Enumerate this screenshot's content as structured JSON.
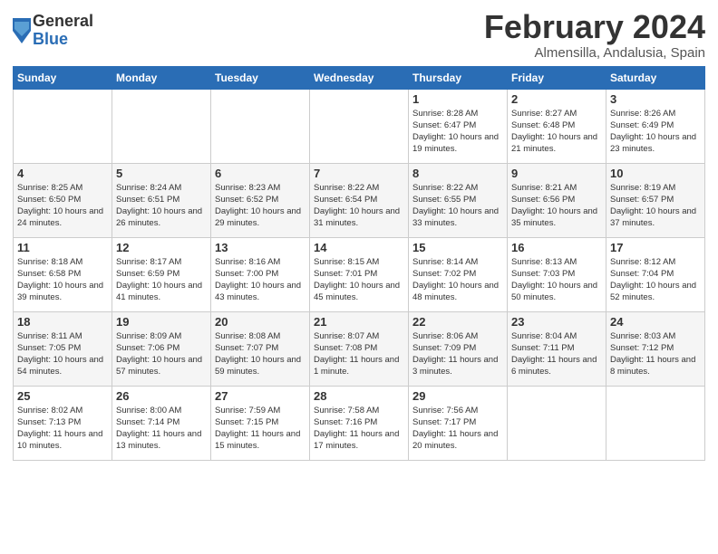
{
  "header": {
    "logo_general": "General",
    "logo_blue": "Blue",
    "month_year": "February 2024",
    "location": "Almensilla, Andalusia, Spain"
  },
  "days_of_week": [
    "Sunday",
    "Monday",
    "Tuesday",
    "Wednesday",
    "Thursday",
    "Friday",
    "Saturday"
  ],
  "weeks": [
    [
      {
        "day": "",
        "info": ""
      },
      {
        "day": "",
        "info": ""
      },
      {
        "day": "",
        "info": ""
      },
      {
        "day": "",
        "info": ""
      },
      {
        "day": "1",
        "info": "Sunrise: 8:28 AM\nSunset: 6:47 PM\nDaylight: 10 hours\nand 19 minutes."
      },
      {
        "day": "2",
        "info": "Sunrise: 8:27 AM\nSunset: 6:48 PM\nDaylight: 10 hours\nand 21 minutes."
      },
      {
        "day": "3",
        "info": "Sunrise: 8:26 AM\nSunset: 6:49 PM\nDaylight: 10 hours\nand 23 minutes."
      }
    ],
    [
      {
        "day": "4",
        "info": "Sunrise: 8:25 AM\nSunset: 6:50 PM\nDaylight: 10 hours\nand 24 minutes."
      },
      {
        "day": "5",
        "info": "Sunrise: 8:24 AM\nSunset: 6:51 PM\nDaylight: 10 hours\nand 26 minutes."
      },
      {
        "day": "6",
        "info": "Sunrise: 8:23 AM\nSunset: 6:52 PM\nDaylight: 10 hours\nand 29 minutes."
      },
      {
        "day": "7",
        "info": "Sunrise: 8:22 AM\nSunset: 6:54 PM\nDaylight: 10 hours\nand 31 minutes."
      },
      {
        "day": "8",
        "info": "Sunrise: 8:22 AM\nSunset: 6:55 PM\nDaylight: 10 hours\nand 33 minutes."
      },
      {
        "day": "9",
        "info": "Sunrise: 8:21 AM\nSunset: 6:56 PM\nDaylight: 10 hours\nand 35 minutes."
      },
      {
        "day": "10",
        "info": "Sunrise: 8:19 AM\nSunset: 6:57 PM\nDaylight: 10 hours\nand 37 minutes."
      }
    ],
    [
      {
        "day": "11",
        "info": "Sunrise: 8:18 AM\nSunset: 6:58 PM\nDaylight: 10 hours\nand 39 minutes."
      },
      {
        "day": "12",
        "info": "Sunrise: 8:17 AM\nSunset: 6:59 PM\nDaylight: 10 hours\nand 41 minutes."
      },
      {
        "day": "13",
        "info": "Sunrise: 8:16 AM\nSunset: 7:00 PM\nDaylight: 10 hours\nand 43 minutes."
      },
      {
        "day": "14",
        "info": "Sunrise: 8:15 AM\nSunset: 7:01 PM\nDaylight: 10 hours\nand 45 minutes."
      },
      {
        "day": "15",
        "info": "Sunrise: 8:14 AM\nSunset: 7:02 PM\nDaylight: 10 hours\nand 48 minutes."
      },
      {
        "day": "16",
        "info": "Sunrise: 8:13 AM\nSunset: 7:03 PM\nDaylight: 10 hours\nand 50 minutes."
      },
      {
        "day": "17",
        "info": "Sunrise: 8:12 AM\nSunset: 7:04 PM\nDaylight: 10 hours\nand 52 minutes."
      }
    ],
    [
      {
        "day": "18",
        "info": "Sunrise: 8:11 AM\nSunset: 7:05 PM\nDaylight: 10 hours\nand 54 minutes."
      },
      {
        "day": "19",
        "info": "Sunrise: 8:09 AM\nSunset: 7:06 PM\nDaylight: 10 hours\nand 57 minutes."
      },
      {
        "day": "20",
        "info": "Sunrise: 8:08 AM\nSunset: 7:07 PM\nDaylight: 10 hours\nand 59 minutes."
      },
      {
        "day": "21",
        "info": "Sunrise: 8:07 AM\nSunset: 7:08 PM\nDaylight: 11 hours\nand 1 minute."
      },
      {
        "day": "22",
        "info": "Sunrise: 8:06 AM\nSunset: 7:09 PM\nDaylight: 11 hours\nand 3 minutes."
      },
      {
        "day": "23",
        "info": "Sunrise: 8:04 AM\nSunset: 7:11 PM\nDaylight: 11 hours\nand 6 minutes."
      },
      {
        "day": "24",
        "info": "Sunrise: 8:03 AM\nSunset: 7:12 PM\nDaylight: 11 hours\nand 8 minutes."
      }
    ],
    [
      {
        "day": "25",
        "info": "Sunrise: 8:02 AM\nSunset: 7:13 PM\nDaylight: 11 hours\nand 10 minutes."
      },
      {
        "day": "26",
        "info": "Sunrise: 8:00 AM\nSunset: 7:14 PM\nDaylight: 11 hours\nand 13 minutes."
      },
      {
        "day": "27",
        "info": "Sunrise: 7:59 AM\nSunset: 7:15 PM\nDaylight: 11 hours\nand 15 minutes."
      },
      {
        "day": "28",
        "info": "Sunrise: 7:58 AM\nSunset: 7:16 PM\nDaylight: 11 hours\nand 17 minutes."
      },
      {
        "day": "29",
        "info": "Sunrise: 7:56 AM\nSunset: 7:17 PM\nDaylight: 11 hours\nand 20 minutes."
      },
      {
        "day": "",
        "info": ""
      },
      {
        "day": "",
        "info": ""
      }
    ]
  ]
}
